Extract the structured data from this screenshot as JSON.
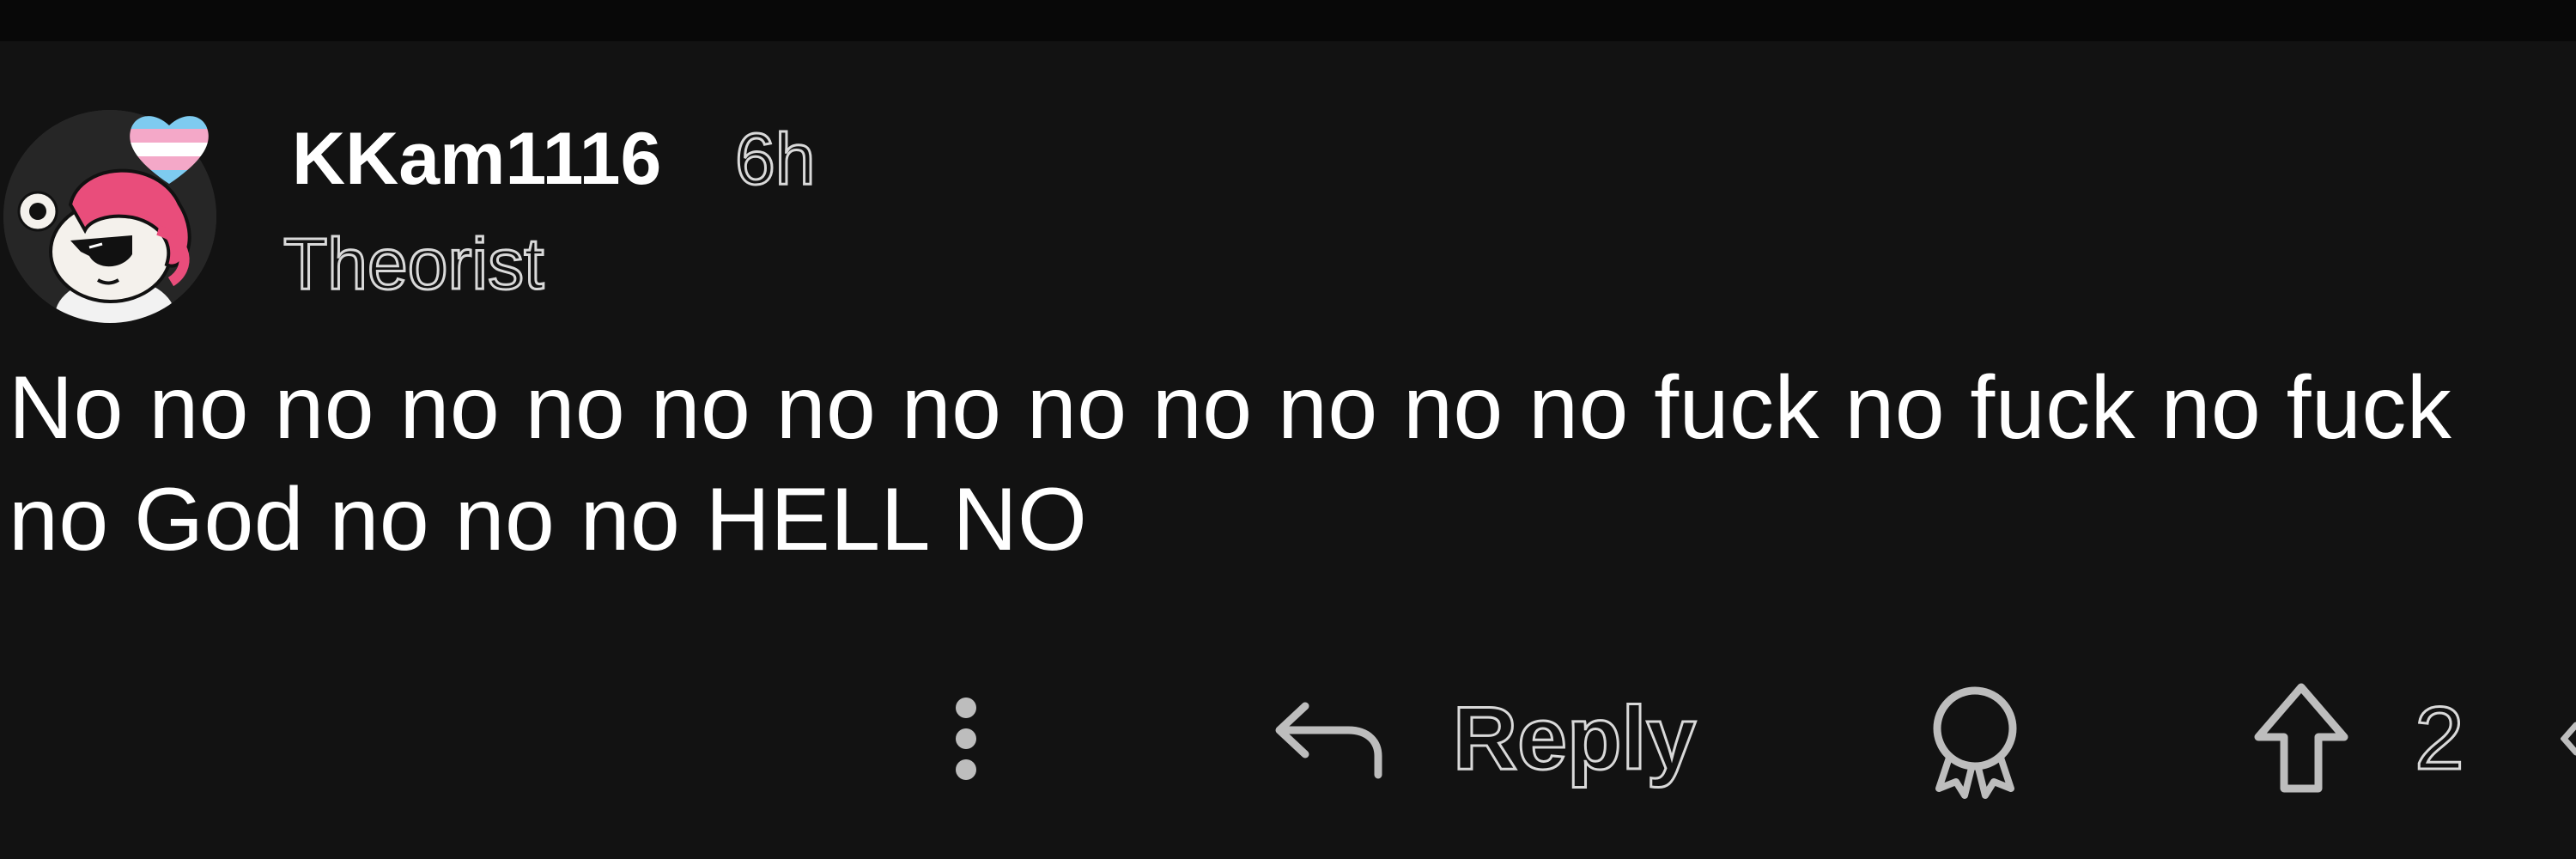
{
  "comment": {
    "username": "KKam1116",
    "timestamp": "6h",
    "user_flair": "Theorist",
    "body": "No no no no no no no no no no no no no fuck no fuck no fuck no God no no no HELL NO"
  },
  "actions": {
    "more_icon": "more-vertical-icon",
    "reply_icon": "reply-arrow-icon",
    "reply_label": "Reply",
    "award_icon": "award-icon",
    "upvote_icon": "upvote-arrow-icon",
    "vote_count": "2"
  },
  "colors": {
    "background": "#121212",
    "top_bar": "#080808",
    "text": "#ffffff",
    "outline_text": "#d9d9d9",
    "avatar_hair": "#e94d7b",
    "flair_heart_blue": "#7ecbf0",
    "flair_heart_pink": "#f4a8c8"
  }
}
